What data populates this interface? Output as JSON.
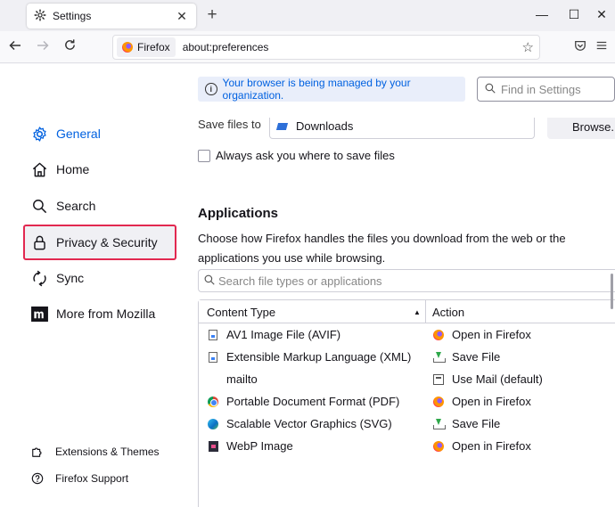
{
  "browser": {
    "tab_title": "Settings",
    "tab_close": "✕",
    "new_tab": "+",
    "window_controls": {
      "minimize": "—",
      "maximize": "☐",
      "close": "✕"
    },
    "identity_label": "Firefox",
    "url": "about:preferences"
  },
  "sidebar": {
    "items": [
      {
        "label": "General",
        "icon": "gear-icon"
      },
      {
        "label": "Home",
        "icon": "home-icon"
      },
      {
        "label": "Search",
        "icon": "search-icon"
      },
      {
        "label": "Privacy & Security",
        "icon": "lock-icon"
      },
      {
        "label": "Sync",
        "icon": "sync-icon"
      },
      {
        "label": "More from Mozilla",
        "icon": "mozilla-logo-icon"
      }
    ],
    "active_index": 0,
    "highlight_index": 3,
    "footer": [
      {
        "label": "Extensions & Themes",
        "icon": "puzzle-icon"
      },
      {
        "label": "Firefox Support",
        "icon": "help-icon"
      }
    ]
  },
  "main": {
    "policy_notice": "Your browser is being managed by your organization.",
    "find_placeholder": "Find in Settings",
    "save_files_label": "Save files to",
    "download_folder": "Downloads",
    "browse_label": "Browse...",
    "always_ask_label": "Always ask you where to save files",
    "applications": {
      "title": "Applications",
      "description": "Choose how Firefox handles the files you download from the web or the applications you use while browsing.",
      "search_placeholder": "Search file types or applications",
      "columns": {
        "content_type": "Content Type",
        "action": "Action"
      },
      "rows": [
        {
          "type": "AV1 Image File (AVIF)",
          "type_icon": "file-icon",
          "action": "Open in Firefox",
          "action_icon": "firefox-icon"
        },
        {
          "type": "Extensible Markup Language (XML)",
          "type_icon": "file-icon",
          "action": "Save File",
          "action_icon": "save-icon"
        },
        {
          "type": "mailto",
          "type_icon": "",
          "action": "Use Mail (default)",
          "action_icon": "mail-app-icon"
        },
        {
          "type": "Portable Document Format (PDF)",
          "type_icon": "chrome-icon",
          "action": "Open in Firefox",
          "action_icon": "firefox-icon"
        },
        {
          "type": "Scalable Vector Graphics (SVG)",
          "type_icon": "edge-icon",
          "action": "Save File",
          "action_icon": "save-icon"
        },
        {
          "type": "WebP Image",
          "type_icon": "webp-icon",
          "action": "Open in Firefox",
          "action_icon": "firefox-icon"
        }
      ]
    }
  },
  "colors": {
    "accent": "#0061e0",
    "highlight_border": "#e22850"
  }
}
